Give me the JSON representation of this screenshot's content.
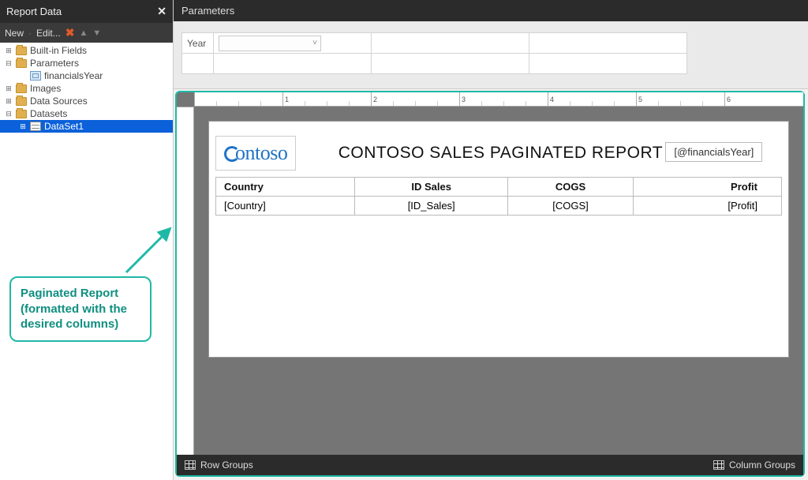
{
  "sidebar": {
    "title": "Report Data",
    "toolbar": {
      "new": "New",
      "edit": "Edit..."
    },
    "tree": {
      "builtin": "Built-in Fields",
      "parameters": "Parameters",
      "financialsYear": "financialsYear",
      "images": "Images",
      "dataSources": "Data Sources",
      "datasets": "Datasets",
      "dataset1": "DataSet1"
    }
  },
  "parameters": {
    "header": "Parameters",
    "label": "Year"
  },
  "ruler": {
    "t1": "1",
    "t2": "2",
    "t3": "3",
    "t4": "4",
    "t5": "5",
    "t6": "6"
  },
  "report": {
    "logo_text": "ontoso",
    "title": "CONTOSO SALES PAGINATED REPORT",
    "param_placeholder": "[@financialsYear]",
    "columns": {
      "c1": "Country",
      "c2": "ID Sales",
      "c3": "COGS",
      "c4": "Profit"
    },
    "row": {
      "c1": "[Country]",
      "c2": "[ID_Sales]",
      "c3": "[COGS]",
      "c4": "[Profit]"
    }
  },
  "groups": {
    "row": "Row Groups",
    "col": "Column Groups"
  },
  "callout": "Paginated Report (formatted with the desired columns)"
}
